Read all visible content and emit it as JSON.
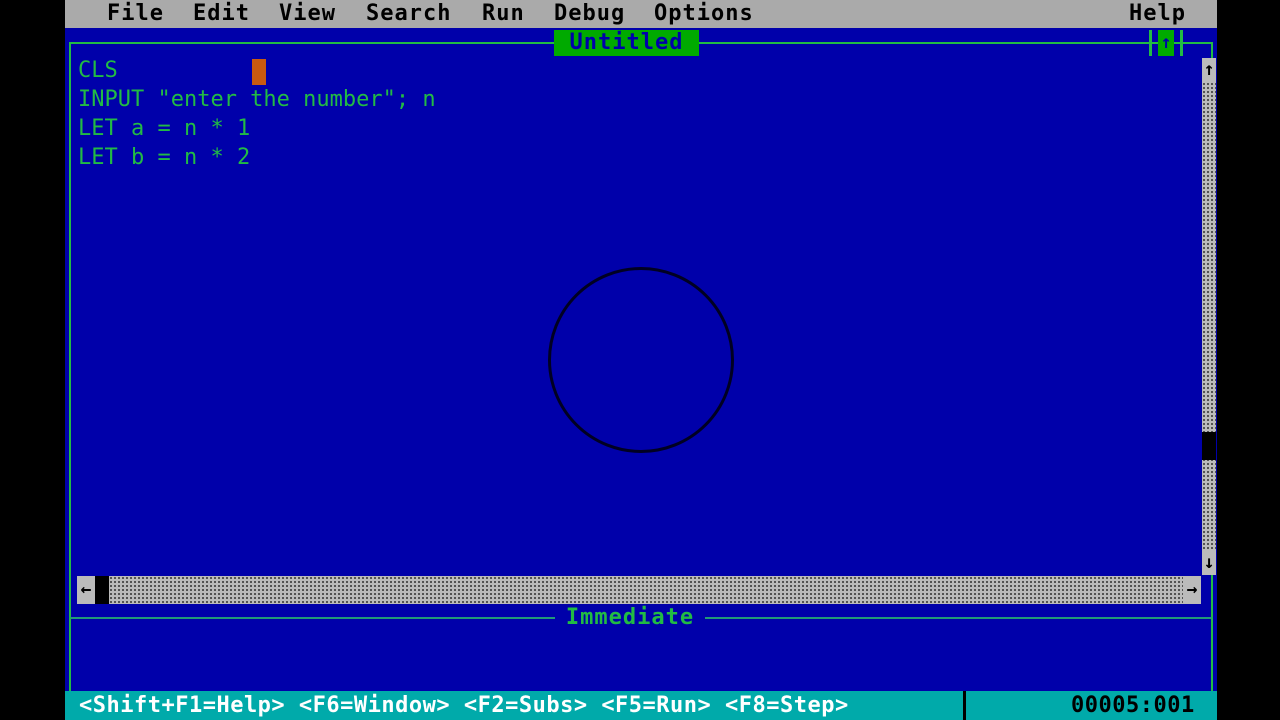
{
  "menu": {
    "file": "File",
    "edit": "Edit",
    "view": "View",
    "search": "Search",
    "run": "Run",
    "debug": "Debug",
    "options": "Options",
    "help": "Help"
  },
  "editor": {
    "title": "Untitled",
    "maximize_glyph": "↑",
    "lines": [
      "CLS",
      "INPUT \"enter the number\"; n",
      "LET a = n * 1",
      "LET b = n * 2"
    ],
    "scroll_up_glyph": "↑",
    "scroll_down_glyph": "↓",
    "scroll_left_glyph": "←",
    "scroll_right_glyph": "→"
  },
  "immediate": {
    "title": "Immediate"
  },
  "status": {
    "keys": "<Shift+F1=Help> <F6=Window> <F2=Subs> <F5=Run> <F8=Step>",
    "position": "00005:001"
  },
  "colors": {
    "background": "#0000aa",
    "text": "#22bb44",
    "menubar": "#aaaaaa",
    "statusbar": "#00aaaa",
    "cursor": "#c85a10"
  }
}
